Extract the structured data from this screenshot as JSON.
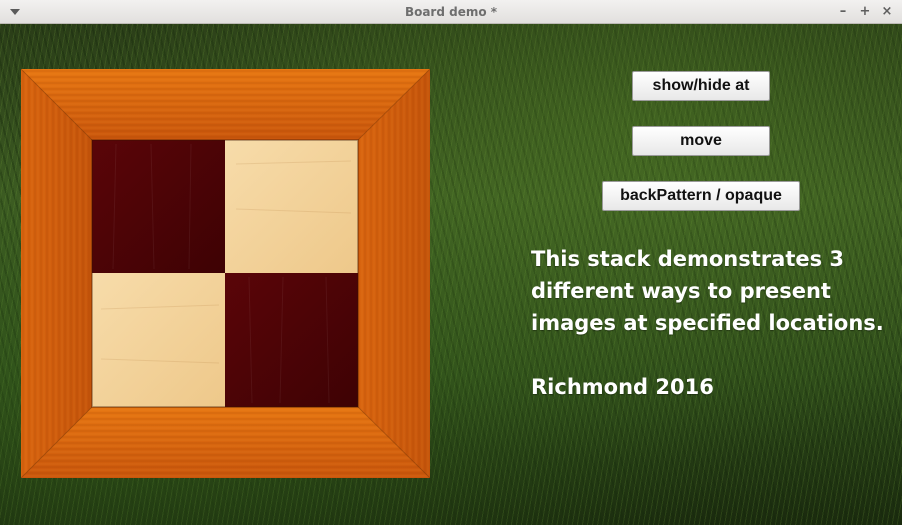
{
  "window": {
    "title": "Board demo *",
    "minimize_glyph": "–",
    "maximize_glyph": "+",
    "close_glyph": "×"
  },
  "buttons": {
    "show_hide": "show/hide at",
    "move": "move",
    "back_pattern": "backPattern / opaque"
  },
  "text": {
    "description": "This stack demonstrates 3\ndifferent ways to present\nimages at specified locations.",
    "credit": "Richmond 2016"
  },
  "board": {
    "squares": [
      "dark",
      "light",
      "light",
      "dark"
    ],
    "colors": {
      "frame": "#d9640f",
      "dark_square": "#4a0306",
      "light_square": "#f3d49c"
    }
  },
  "icons": {
    "window_menu": "chevron-down-icon"
  }
}
